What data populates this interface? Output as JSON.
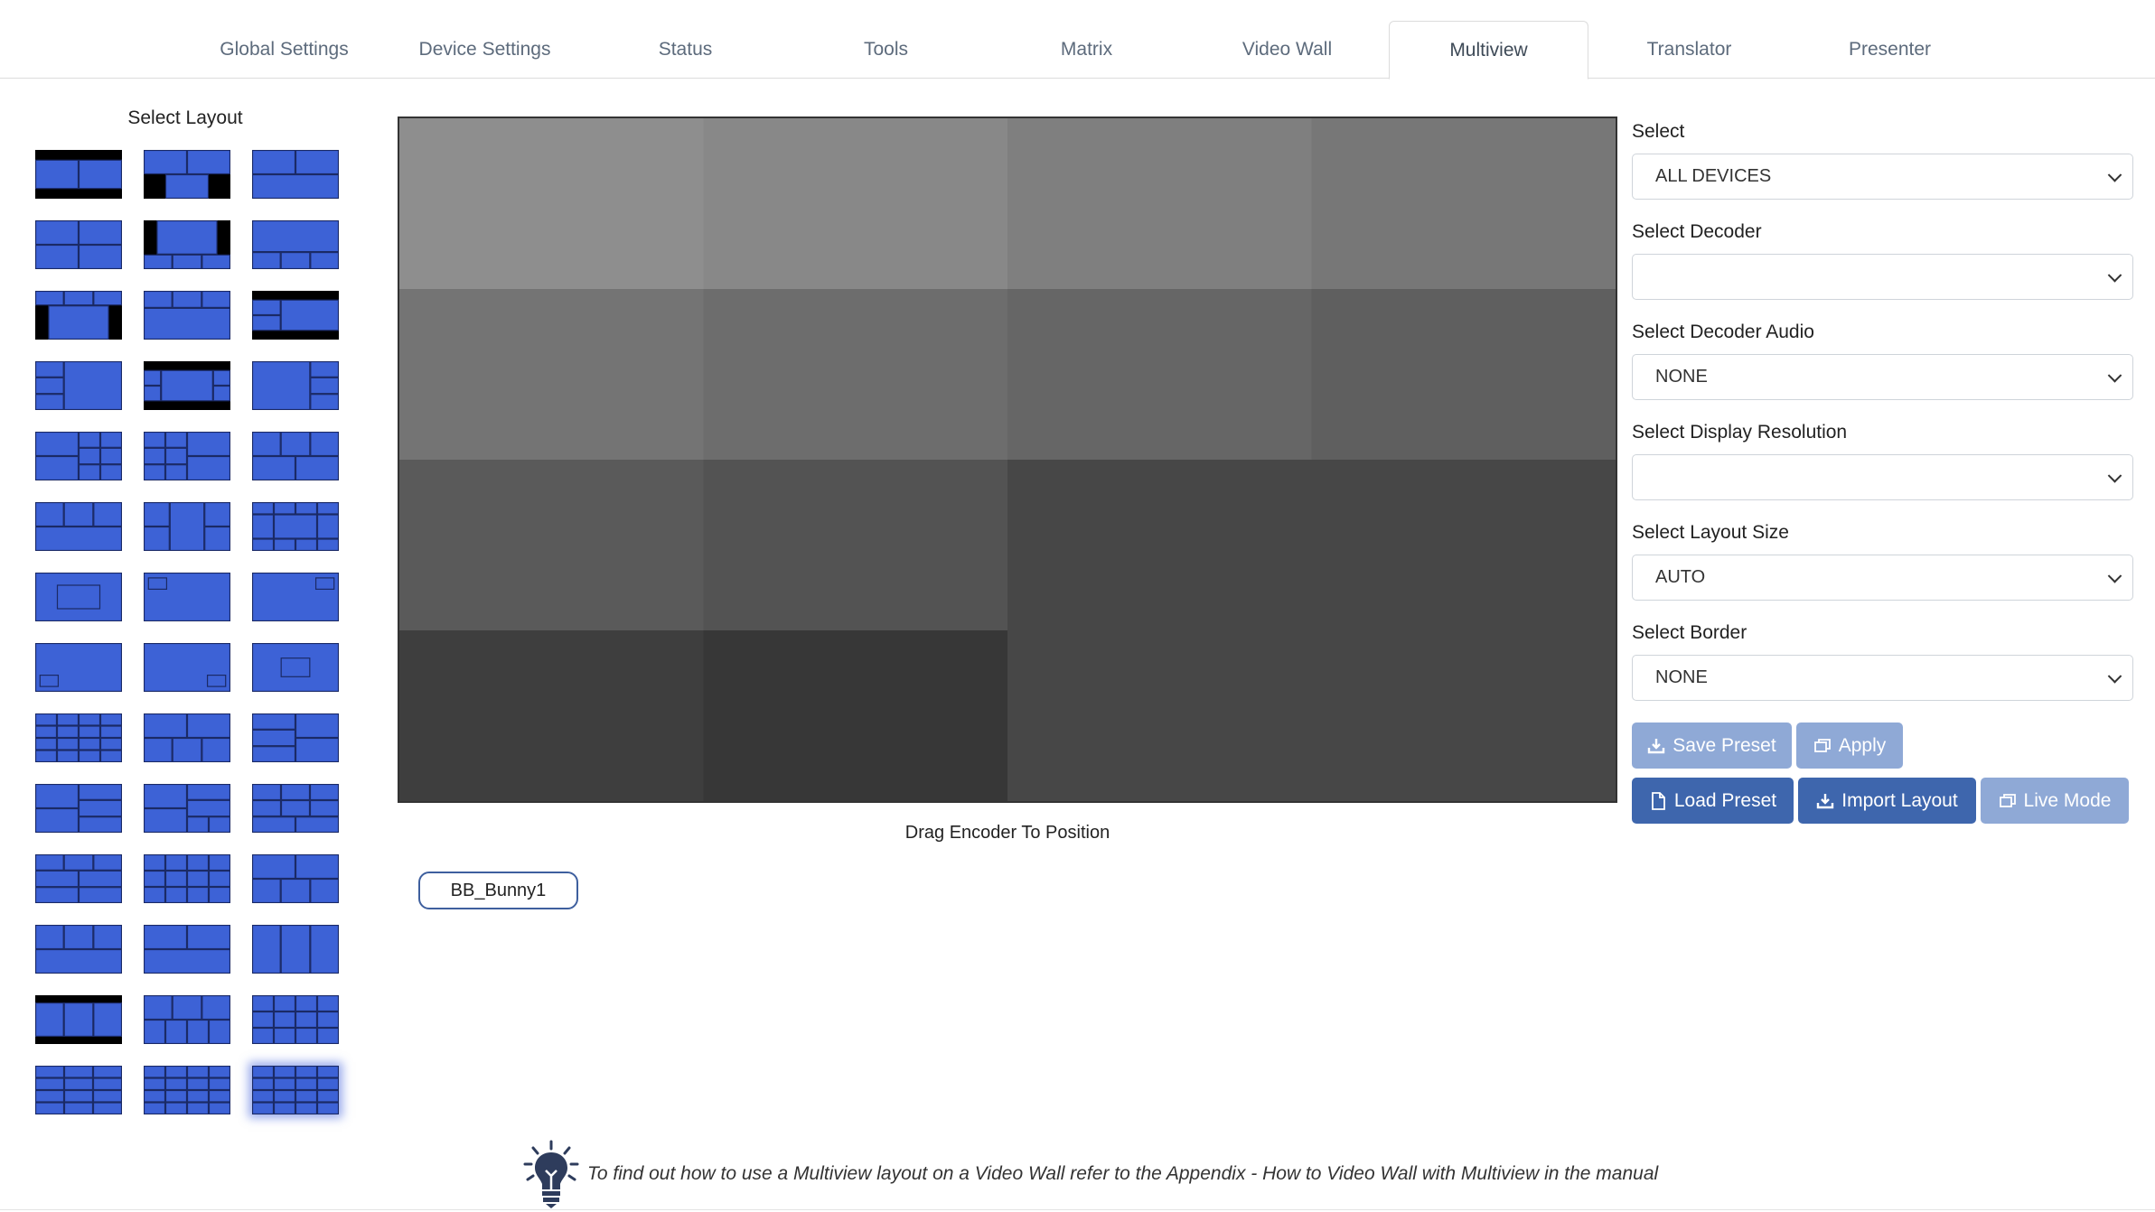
{
  "tabs": [
    {
      "label": "Global Settings",
      "active": false
    },
    {
      "label": "Device Settings",
      "active": false
    },
    {
      "label": "Status",
      "active": false
    },
    {
      "label": "Tools",
      "active": false
    },
    {
      "label": "Matrix",
      "active": false
    },
    {
      "label": "Video Wall",
      "active": false
    },
    {
      "label": "Multiview",
      "active": true
    },
    {
      "label": "Translator",
      "active": false
    },
    {
      "label": "Presenter",
      "active": false
    }
  ],
  "layout_picker": {
    "title": "Select Layout",
    "count": 42,
    "selected_index": 41,
    "colors": {
      "tile": "#3d62d6",
      "tile_edge": "#1b2a66",
      "black": "#000000"
    }
  },
  "canvas": {
    "cell_shades": [
      [
        "#8e8e8e",
        "#888888",
        "#7f7f7f",
        "#777777"
      ],
      [
        "#747474",
        "#6d6d6d",
        "#666666",
        "#5f5f5f"
      ],
      [
        "#5a5a5a",
        "#535353",
        "#474747",
        "#474747"
      ],
      [
        "#3e3e3e",
        "#373737",
        "#474747",
        "#474747"
      ]
    ],
    "caption": "Drag Encoder To Position",
    "encoders": [
      "BB_Bunny1"
    ]
  },
  "form": {
    "select": {
      "label": "Select",
      "value": "ALL DEVICES"
    },
    "decoder": {
      "label": "Select Decoder",
      "value": ""
    },
    "decoder_audio": {
      "label": "Select Decoder Audio",
      "value": "NONE"
    },
    "display_resolution": {
      "label": "Select Display Resolution",
      "value": ""
    },
    "layout_size": {
      "label": "Select Layout Size",
      "value": "AUTO"
    },
    "border": {
      "label": "Select Border",
      "value": "NONE"
    }
  },
  "buttons": {
    "save_preset": "Save Preset",
    "apply": "Apply",
    "load_preset": "Load Preset",
    "import_layout": "Import Layout",
    "live_mode": "Live Mode"
  },
  "colors": {
    "accent": "#3e66ad",
    "accent_light": "#8fa9d6",
    "tab_text": "#5d6b7c"
  },
  "footer_tip": "To find out how to use a Multiview layout on a Video Wall refer to the Appendix - How to Video Wall with Multiview in the manual"
}
